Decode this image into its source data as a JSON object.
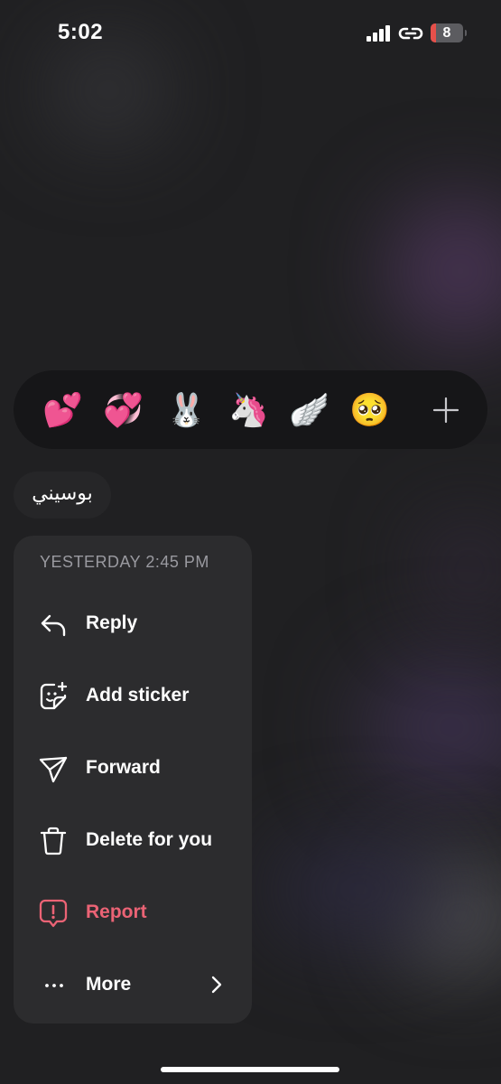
{
  "status_bar": {
    "time": "5:02",
    "battery_level": "8"
  },
  "reactions": {
    "emojis": [
      "💕",
      "💞",
      "🐰",
      "🦄",
      "🪽",
      "🥺"
    ],
    "more_icon": "plus-icon"
  },
  "message": {
    "text": "بوسيني"
  },
  "menu": {
    "header": "YESTERDAY 2:45 PM",
    "items": [
      {
        "label": "Reply",
        "icon": "reply-icon"
      },
      {
        "label": "Add sticker",
        "icon": "sticker-icon"
      },
      {
        "label": "Forward",
        "icon": "send-icon"
      },
      {
        "label": "Delete for you",
        "icon": "trash-icon"
      },
      {
        "label": "Report",
        "icon": "report-icon",
        "color": "#eb6375"
      },
      {
        "label": "More",
        "icon": "more-icon"
      }
    ]
  }
}
